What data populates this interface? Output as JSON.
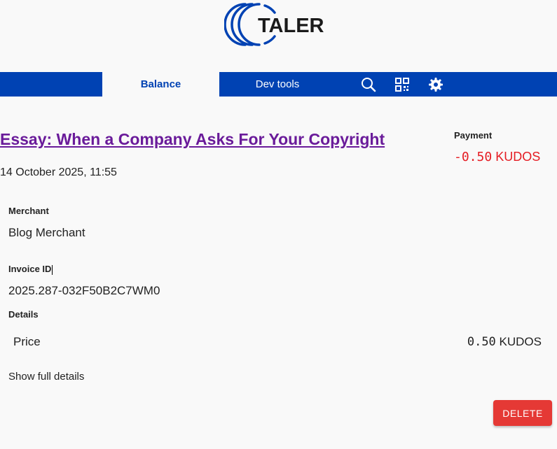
{
  "header": {
    "logo_text": "TALER"
  },
  "nav": {
    "balance": "Balance",
    "dev_tools": "Dev tools",
    "icons": [
      "search-icon",
      "qr-code-icon",
      "gear-icon"
    ]
  },
  "transaction": {
    "title": "Essay: When a Company Asks For Your Copyright",
    "date": "14 October 2025, 11:55",
    "payment_label": "Payment",
    "payment_amount": "-0.50",
    "payment_currency": "KUDOS",
    "merchant_label": "Merchant",
    "merchant_value": "Blog Merchant",
    "invoice_label": "Invoice ID",
    "invoice_value": "2025.287-032F50B2C7WM0",
    "details_label": "Details",
    "price_label": "Price",
    "price_amount": "0.50",
    "price_currency": "KUDOS",
    "show_full_details": "Show full details",
    "delete_label": "DELETE"
  },
  "colors": {
    "brand": "#0042b3",
    "link": "#6a1b9a",
    "negative": "#e51c23",
    "danger": "#e53935"
  }
}
